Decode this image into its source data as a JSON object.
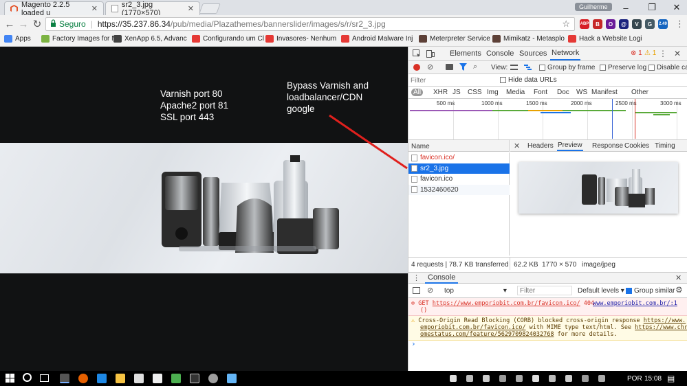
{
  "tabs": [
    {
      "title": "Magento 2.2.5 loaded u",
      "favicon_color": "#e4572e",
      "active": false
    },
    {
      "title": "sr2_3.jpg (1770×570)",
      "favicon_color": "#ffffff",
      "active": true
    }
  ],
  "user_label": "Guilherme",
  "address": {
    "secure_label": "Seguro",
    "url_host": "https://35.237.86.34",
    "url_path": "/pub/media/Plazathemes/bannerslider/images/s/r/sr2_3.jpg"
  },
  "extensions": [
    {
      "label": "ABP",
      "color": "#d71f26"
    },
    {
      "label": "B",
      "color": "#c62828"
    },
    {
      "label": "O",
      "color": "#6a1b9a"
    },
    {
      "label": "@",
      "color": "#1a237e"
    },
    {
      "label": "V",
      "color": "#37474f"
    },
    {
      "label": "G",
      "color": "#455a64"
    },
    {
      "label": "2.49",
      "color": "#1565c0"
    }
  ],
  "bookmarks": [
    {
      "label": "Apps",
      "color": "#4285f4"
    },
    {
      "label": "Factory Images for N",
      "color": "#7cb342"
    },
    {
      "label": "XenApp 6.5, Advanc",
      "color": "#424242"
    },
    {
      "label": "Configurando um Cl",
      "color": "#e53935"
    },
    {
      "label": "Invasores- Nenhum",
      "color": "#e53935"
    },
    {
      "label": "Android Malware Inj",
      "color": "#e53935"
    },
    {
      "label": "Meterpreter Service",
      "color": "#5d4037"
    },
    {
      "label": "Mimikatz - Metasplo",
      "color": "#5d4037"
    },
    {
      "label": "Hack a Website Logi",
      "color": "#e53935"
    }
  ],
  "annotations": {
    "ports": "Varnish port 80\nApache2 port 81\nSSL port 443",
    "bypass": "Bypass Varnish and\nloadbalancer/CDN\ngoogle"
  },
  "devtools": {
    "panels": [
      "Elements",
      "Console",
      "Sources",
      "Network"
    ],
    "active_panel": "Network",
    "errors": "1",
    "warnings": "1",
    "toolbar": {
      "view_label": "View:",
      "group_by_frame": "Group by frame",
      "preserve_log": "Preserve log",
      "disable_cache": "Disable cac"
    },
    "filter_placeholder": "Filter",
    "hide_data_urls": "Hide data URLs",
    "filter_types": [
      "All",
      "XHR",
      "JS",
      "CSS",
      "Img",
      "Media",
      "Font",
      "Doc",
      "WS",
      "Manifest",
      "Other"
    ],
    "timeline_ticks": [
      "500 ms",
      "1000 ms",
      "1500 ms",
      "2000 ms",
      "2500 ms",
      "3000 ms"
    ],
    "name_header": "Name",
    "requests": [
      {
        "name": "favicon.ico/",
        "error": true,
        "selected": false
      },
      {
        "name": "sr2_3.jpg",
        "error": false,
        "selected": true
      },
      {
        "name": "favicon.ico",
        "error": false,
        "selected": false
      },
      {
        "name": "1532460620",
        "error": false,
        "selected": false
      }
    ],
    "detail_tabs": [
      "Headers",
      "Preview",
      "Response",
      "Cookies",
      "Timing"
    ],
    "active_detail_tab": "Preview",
    "summary": "4 requests | 78.7 KB transferred",
    "preview_info": {
      "size": "62.2 KB",
      "dims": "1770 × 570",
      "mime": "image/jpeg"
    },
    "console": {
      "title": "Console",
      "context": "top",
      "filter_placeholder": "Filter",
      "levels": "Default levels",
      "group_similar": "Group similar",
      "error_method": "GET",
      "error_url": "https://www.emporiobit.com.br/favicon.ico/",
      "error_code": "404",
      "error_source": "www.emporiobit.com.br/:1",
      "error_paren": "()",
      "warn_line1_pre": "Cross-Origin Read Blocking (CORB) blocked cross-origin response ",
      "warn_line1_link": "https://www.",
      "warn_line2_link": "emporiobit.com.br/favicon.ico/",
      "warn_line2_mid": " with MIME type text/html. See ",
      "warn_line2_link2": "https://www.chr",
      "warn_line3_link": "omestatus.com/feature/5629709824032768",
      "warn_line3_post": " for more details.",
      "prompt": "›"
    }
  },
  "taskbar": {
    "lang": "POR",
    "time": "15:08"
  }
}
